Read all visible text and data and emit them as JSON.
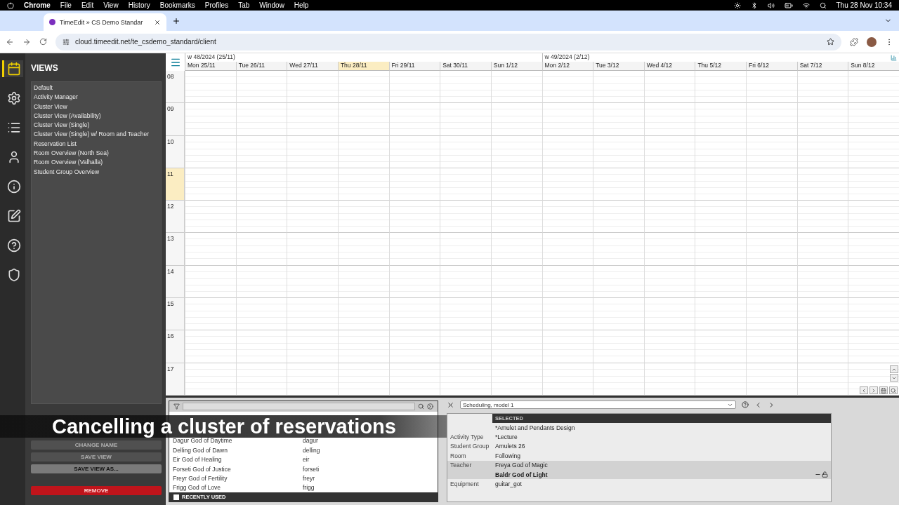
{
  "menu_bar": {
    "app": "Chrome",
    "menus": [
      "File",
      "Edit",
      "View",
      "History",
      "Bookmarks",
      "Profiles",
      "Tab",
      "Window",
      "Help"
    ],
    "clock": "Thu 28 Nov  10:34"
  },
  "browser": {
    "tab": {
      "title": "TimeEdit » CS Demo Standar"
    },
    "url": "cloud.timeedit.net/te_csdemo_standard/client"
  },
  "rail": [
    {
      "kind": "calendar",
      "selected": true
    },
    {
      "kind": "gears",
      "selected": false
    },
    {
      "kind": "list",
      "selected": false
    },
    {
      "kind": "user",
      "selected": false
    },
    {
      "kind": "info",
      "selected": false
    },
    {
      "kind": "edit",
      "selected": false
    },
    {
      "kind": "help",
      "selected": false
    },
    {
      "kind": "shield",
      "selected": false
    }
  ],
  "views": {
    "title": "VIEWS",
    "items": [
      "Default",
      "Activity Manager",
      "Cluster View",
      "Cluster View (Availability)",
      "Cluster View (Single)",
      "Cluster View (Single) w/ Room and Teacher",
      "Reservation List",
      "Room Overview (North Sea)",
      "Room Overview (Valhalla)",
      "Student Group Overview"
    ],
    "buttons": [
      {
        "label": "CHANGE NAME",
        "kind": "normal",
        "disabled": true
      },
      {
        "label": "SAVE VIEW",
        "kind": "normal",
        "disabled": true
      },
      {
        "label": "SAVE VIEW AS...",
        "kind": "normal",
        "disabled": false
      },
      {
        "label": "REMOVE",
        "kind": "danger",
        "disabled": false
      }
    ]
  },
  "calendar": {
    "weeks": [
      {
        "label": "w 48/2024 (25/11)"
      },
      {
        "label": "w 49/2024 (2/12)"
      }
    ],
    "days": [
      {
        "label": "Mon 25/11",
        "today": false
      },
      {
        "label": "Tue 26/11",
        "today": false
      },
      {
        "label": "Wed 27/11",
        "today": false
      },
      {
        "label": "Thu 28/11",
        "today": true
      },
      {
        "label": "Fri 29/11",
        "today": false
      },
      {
        "label": "Sat 30/11",
        "today": false
      },
      {
        "label": "Sun 1/12",
        "today": false
      },
      {
        "label": "Mon 2/12",
        "today": false
      },
      {
        "label": "Tue 3/12",
        "today": false
      },
      {
        "label": "Wed 4/12",
        "today": false
      },
      {
        "label": "Thu 5/12",
        "today": false
      },
      {
        "label": "Fri 6/12",
        "today": false
      },
      {
        "label": "Sat 7/12",
        "today": false
      },
      {
        "label": "Sun 8/12",
        "today": false
      }
    ],
    "hours": [
      {
        "label": "08",
        "current": false
      },
      {
        "label": "09",
        "current": false
      },
      {
        "label": "10",
        "current": false
      },
      {
        "label": "11",
        "current": true
      },
      {
        "label": "12",
        "current": false
      },
      {
        "label": "13",
        "current": false
      },
      {
        "label": "14",
        "current": false
      },
      {
        "label": "15",
        "current": false
      },
      {
        "label": "16",
        "current": false
      },
      {
        "label": "17",
        "current": false
      }
    ]
  },
  "caption": "Cancelling a cluster of reservations",
  "object_list": {
    "rows": [
      {
        "name": "Dagur God of Daytime",
        "id": "dagur"
      },
      {
        "name": "Delling God of Dawn",
        "id": "delling"
      },
      {
        "name": "Eir God of Healing",
        "id": "eir"
      },
      {
        "name": "Forseti God of Justice",
        "id": "forseti"
      },
      {
        "name": "Freyr God of Fertility",
        "id": "freyr"
      },
      {
        "name": "Frigg God of Love",
        "id": "frigg"
      }
    ],
    "recently_used": {
      "label": "RECENTLY USED",
      "checked": false
    }
  },
  "selection": {
    "model": "Scheduling, model 1",
    "header": "SELECTED",
    "rows": [
      {
        "value": "*Amulet and Pendants Design",
        "selected": false
      },
      {
        "label": "Activity Type",
        "value": "*Lecture",
        "selected": false
      },
      {
        "label": "Student Group",
        "value": "Amulets 26",
        "selected": false
      },
      {
        "label": "Room",
        "value": "Following",
        "selected": false
      },
      {
        "label": "Teacher",
        "value": "Freya God of Magic",
        "selected": true
      },
      {
        "value": "Baldr God of Light",
        "selected": true,
        "bold": true
      },
      {
        "label": "Equipment",
        "value": "guitar_got",
        "selected": false
      }
    ]
  }
}
